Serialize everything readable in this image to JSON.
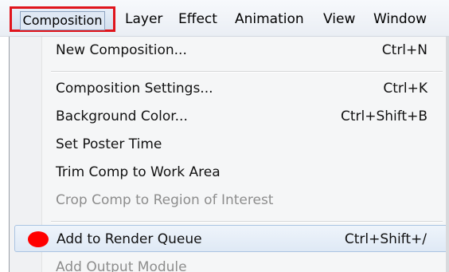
{
  "menubar": {
    "items": [
      {
        "label": "Composition",
        "active": true
      },
      {
        "label": "Layer"
      },
      {
        "label": "Effect"
      },
      {
        "label": "Animation"
      },
      {
        "label": "View"
      },
      {
        "label": "Window"
      }
    ]
  },
  "menu": {
    "items": [
      {
        "label": "New Composition...",
        "shortcut": "Ctrl+N",
        "enabled": true
      },
      {
        "label": "Composition Settings...",
        "shortcut": "Ctrl+K",
        "enabled": true
      },
      {
        "label": "Background Color...",
        "shortcut": "Ctrl+Shift+B",
        "enabled": true
      },
      {
        "label": "Set Poster Time",
        "shortcut": "",
        "enabled": true
      },
      {
        "label": "Trim Comp to Work Area",
        "shortcut": "",
        "enabled": true
      },
      {
        "label": "Crop Comp to Region of Interest",
        "shortcut": "",
        "enabled": false
      },
      {
        "label": "Add to Render Queue",
        "shortcut": "Ctrl+Shift+/",
        "enabled": true,
        "highlighted": true
      },
      {
        "label": "Add Output Module",
        "shortcut": "",
        "enabled": false
      }
    ]
  },
  "colors": {
    "highlight_border": "#e0141c",
    "marker": "#ff0000"
  }
}
